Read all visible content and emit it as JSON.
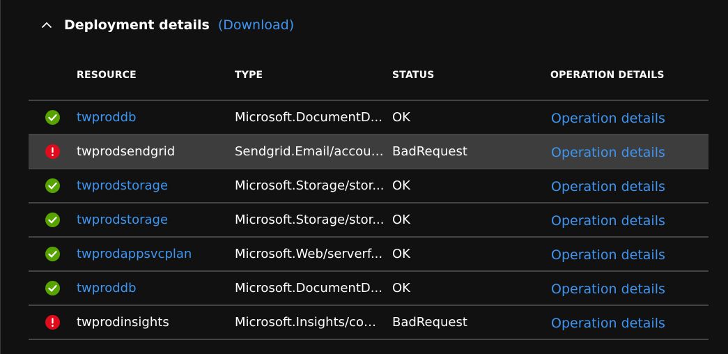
{
  "section": {
    "title": "Deployment details",
    "download_label": "(Download)"
  },
  "table": {
    "columns": [
      "RESOURCE",
      "TYPE",
      "STATUS",
      "OPERATION DETAILS"
    ],
    "rows": [
      {
        "resource": "twproddb",
        "type": "Microsoft.DocumentD...",
        "status": "OK",
        "operation": "Operation details",
        "icon": "success-check-icon",
        "resource_is_link": true
      },
      {
        "resource": "twprodsendgrid",
        "type": "Sendgrid.Email/accounts",
        "status": "BadRequest",
        "operation": "Operation details",
        "icon": "error-exclamation-icon",
        "resource_is_link": false
      },
      {
        "resource": "twprodstorage",
        "type": "Microsoft.Storage/stor...",
        "status": "OK",
        "operation": "Operation details",
        "icon": "success-check-icon",
        "resource_is_link": true
      },
      {
        "resource": "twprodstorage",
        "type": "Microsoft.Storage/stor...",
        "status": "OK",
        "operation": "Operation details",
        "icon": "success-check-icon",
        "resource_is_link": true
      },
      {
        "resource": "twprodappsvcplan",
        "type": "Microsoft.Web/serverf...",
        "status": "OK",
        "operation": "Operation details",
        "icon": "success-check-icon",
        "resource_is_link": true
      },
      {
        "resource": "twproddb",
        "type": "Microsoft.DocumentD...",
        "status": "OK",
        "operation": "Operation details",
        "icon": "success-check-icon",
        "resource_is_link": true
      },
      {
        "resource": "twprodinsights",
        "type": "Microsoft.Insights/com...",
        "status": "BadRequest",
        "operation": "Operation details",
        "icon": "error-exclamation-icon",
        "resource_is_link": false
      }
    ]
  },
  "colors": {
    "background": "#111111",
    "link": "#3f95ef",
    "success": "#57a300",
    "error": "#e00b1c",
    "selected_row": "#3d3d3d",
    "divider": "#444444"
  }
}
